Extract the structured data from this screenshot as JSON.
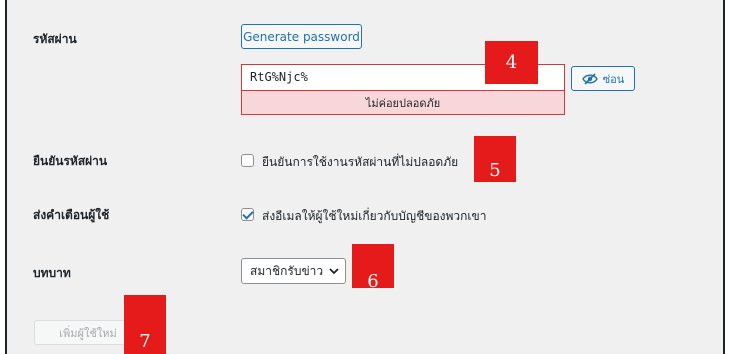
{
  "form": {
    "password_label": "รหัสผ่าน",
    "generate_button": "Generate password",
    "password_value": "RtG%Njc%",
    "strength_text": "ไม่ค่อยปลอดภัย",
    "hide_button": "ซ่อน",
    "confirm_label": "ยืนยันรหัสผ่าน",
    "confirm_checkbox_text": "ยืนยันการใช้งานรหัสผ่านที่ไม่ปลอดภัย",
    "confirm_checked": false,
    "notify_label": "ส่งคำเตือนผู้ใช้",
    "notify_checkbox_text": "ส่งอีเมลให้ผู้ใช้ใหม่เกี่ยวกับบัญชีของพวกเขา",
    "notify_checked": true,
    "role_label": "บทบาท",
    "role_selected": "สมาชิกรับข่าว",
    "add_user_button": "เพิ่มผู้ใช้ใหม่"
  },
  "markers": [
    "4",
    "5",
    "6",
    "7"
  ],
  "colors": {
    "accent": "#2271b1",
    "error": "#d63638",
    "strength_bg": "#f8d7da",
    "marker": "#e51b1b",
    "panel_bg": "#f0f0f1"
  },
  "icons": {
    "hide": "eye-slash-icon",
    "dropdown": "chevron-down-icon",
    "check": "checkmark-icon"
  }
}
